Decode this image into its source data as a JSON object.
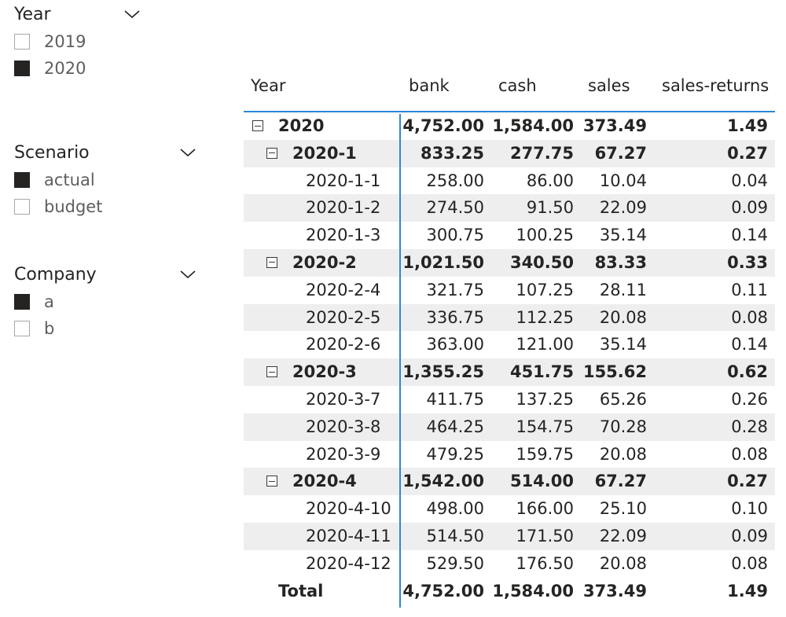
{
  "slicers": {
    "year": {
      "title": "Year",
      "items": [
        {
          "label": "2019",
          "checked": false
        },
        {
          "label": "2020",
          "checked": true
        }
      ]
    },
    "scenario": {
      "title": "Scenario",
      "items": [
        {
          "label": "actual",
          "checked": true
        },
        {
          "label": "budget",
          "checked": false
        }
      ]
    },
    "company": {
      "title": "Company",
      "items": [
        {
          "label": "a",
          "checked": true
        },
        {
          "label": "b",
          "checked": false
        }
      ]
    }
  },
  "matrix": {
    "headers": {
      "year": "Year",
      "bank": "bank",
      "cash": "cash",
      "sales": "sales",
      "returns": "sales-returns"
    },
    "rows": [
      {
        "label": "2020",
        "bank": "4,752.00",
        "cash": "1,584.00",
        "sales": "373.49",
        "returns": "1.49"
      },
      {
        "label": "2020-1",
        "bank": "833.25",
        "cash": "277.75",
        "sales": "67.27",
        "returns": "0.27"
      },
      {
        "label": "2020-1-1",
        "bank": "258.00",
        "cash": "86.00",
        "sales": "10.04",
        "returns": "0.04"
      },
      {
        "label": "2020-1-2",
        "bank": "274.50",
        "cash": "91.50",
        "sales": "22.09",
        "returns": "0.09"
      },
      {
        "label": "2020-1-3",
        "bank": "300.75",
        "cash": "100.25",
        "sales": "35.14",
        "returns": "0.14"
      },
      {
        "label": "2020-2",
        "bank": "1,021.50",
        "cash": "340.50",
        "sales": "83.33",
        "returns": "0.33"
      },
      {
        "label": "2020-2-4",
        "bank": "321.75",
        "cash": "107.25",
        "sales": "28.11",
        "returns": "0.11"
      },
      {
        "label": "2020-2-5",
        "bank": "336.75",
        "cash": "112.25",
        "sales": "20.08",
        "returns": "0.08"
      },
      {
        "label": "2020-2-6",
        "bank": "363.00",
        "cash": "121.00",
        "sales": "35.14",
        "returns": "0.14"
      },
      {
        "label": "2020-3",
        "bank": "1,355.25",
        "cash": "451.75",
        "sales": "155.62",
        "returns": "0.62"
      },
      {
        "label": "2020-3-7",
        "bank": "411.75",
        "cash": "137.25",
        "sales": "65.26",
        "returns": "0.26"
      },
      {
        "label": "2020-3-8",
        "bank": "464.25",
        "cash": "154.75",
        "sales": "70.28",
        "returns": "0.28"
      },
      {
        "label": "2020-3-9",
        "bank": "479.25",
        "cash": "159.75",
        "sales": "20.08",
        "returns": "0.08"
      },
      {
        "label": "2020-4",
        "bank": "1,542.00",
        "cash": "514.00",
        "sales": "67.27",
        "returns": "0.27"
      },
      {
        "label": "2020-4-10",
        "bank": "498.00",
        "cash": "166.00",
        "sales": "25.10",
        "returns": "0.10"
      },
      {
        "label": "2020-4-11",
        "bank": "514.50",
        "cash": "171.50",
        "sales": "22.09",
        "returns": "0.09"
      },
      {
        "label": "2020-4-12",
        "bank": "529.50",
        "cash": "176.50",
        "sales": "20.08",
        "returns": "0.08"
      }
    ],
    "total": {
      "label": "Total",
      "bank": "4,752.00",
      "cash": "1,584.00",
      "sales": "373.49",
      "returns": "1.49"
    }
  },
  "colors": {
    "accent_line": "#2b88d8",
    "checked_box": "#252423",
    "band": "#eeeeee"
  },
  "icons": {
    "slicer_toggle": "chevron-down-icon",
    "row_toggle": "collapse-minus-icon"
  }
}
